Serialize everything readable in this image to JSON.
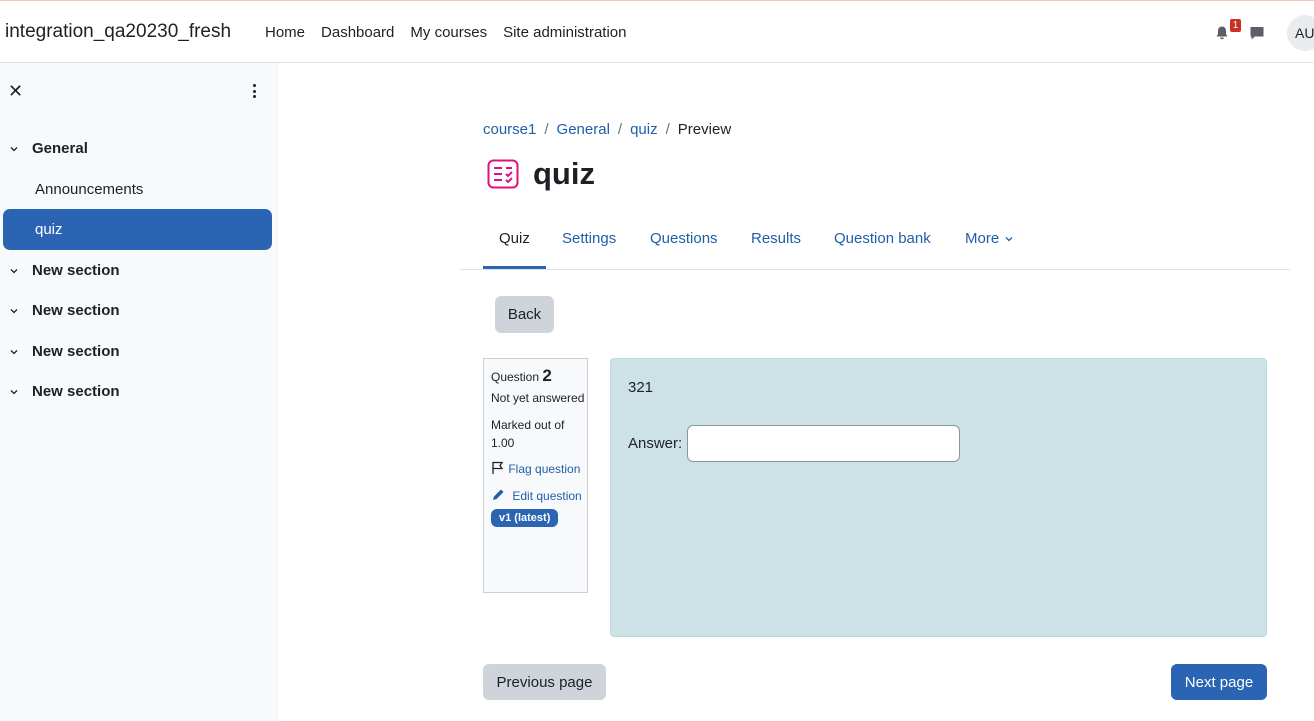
{
  "header": {
    "site_name": "integration_qa20230_fresh",
    "nav": [
      "Home",
      "Dashboard",
      "My courses",
      "Site administration"
    ],
    "notification_count": "1",
    "avatar_initials": "AU"
  },
  "sidebar": {
    "sections": [
      {
        "label": "General",
        "items": [
          {
            "label": "Announcements"
          },
          {
            "label": "quiz",
            "active": true
          }
        ]
      },
      {
        "label": "New section"
      },
      {
        "label": "New section"
      },
      {
        "label": "New section"
      },
      {
        "label": "New section"
      }
    ]
  },
  "breadcrumb": [
    "course1",
    "General",
    "quiz",
    "Preview"
  ],
  "page_title": "quiz",
  "tabs": [
    "Quiz",
    "Settings",
    "Questions",
    "Results",
    "Question bank",
    "More"
  ],
  "back_button": "Back",
  "question": {
    "label": "Question",
    "number": "2",
    "state": "Not yet answered",
    "marks": "Marked out of 1.00",
    "flag_label": "Flag question",
    "edit_label": "Edit question",
    "version": "v1 (latest)",
    "text": "321",
    "answer_label": "Answer:",
    "answer_value": ""
  },
  "footer_buttons": {
    "previous": "Previous page",
    "next": "Next page"
  },
  "colors": {
    "primary": "#2a64b3",
    "link": "#1f5fa9",
    "question_bg": "#cce2e6",
    "badge_red": "#ca3120",
    "icon_pink": "#e0107e"
  }
}
